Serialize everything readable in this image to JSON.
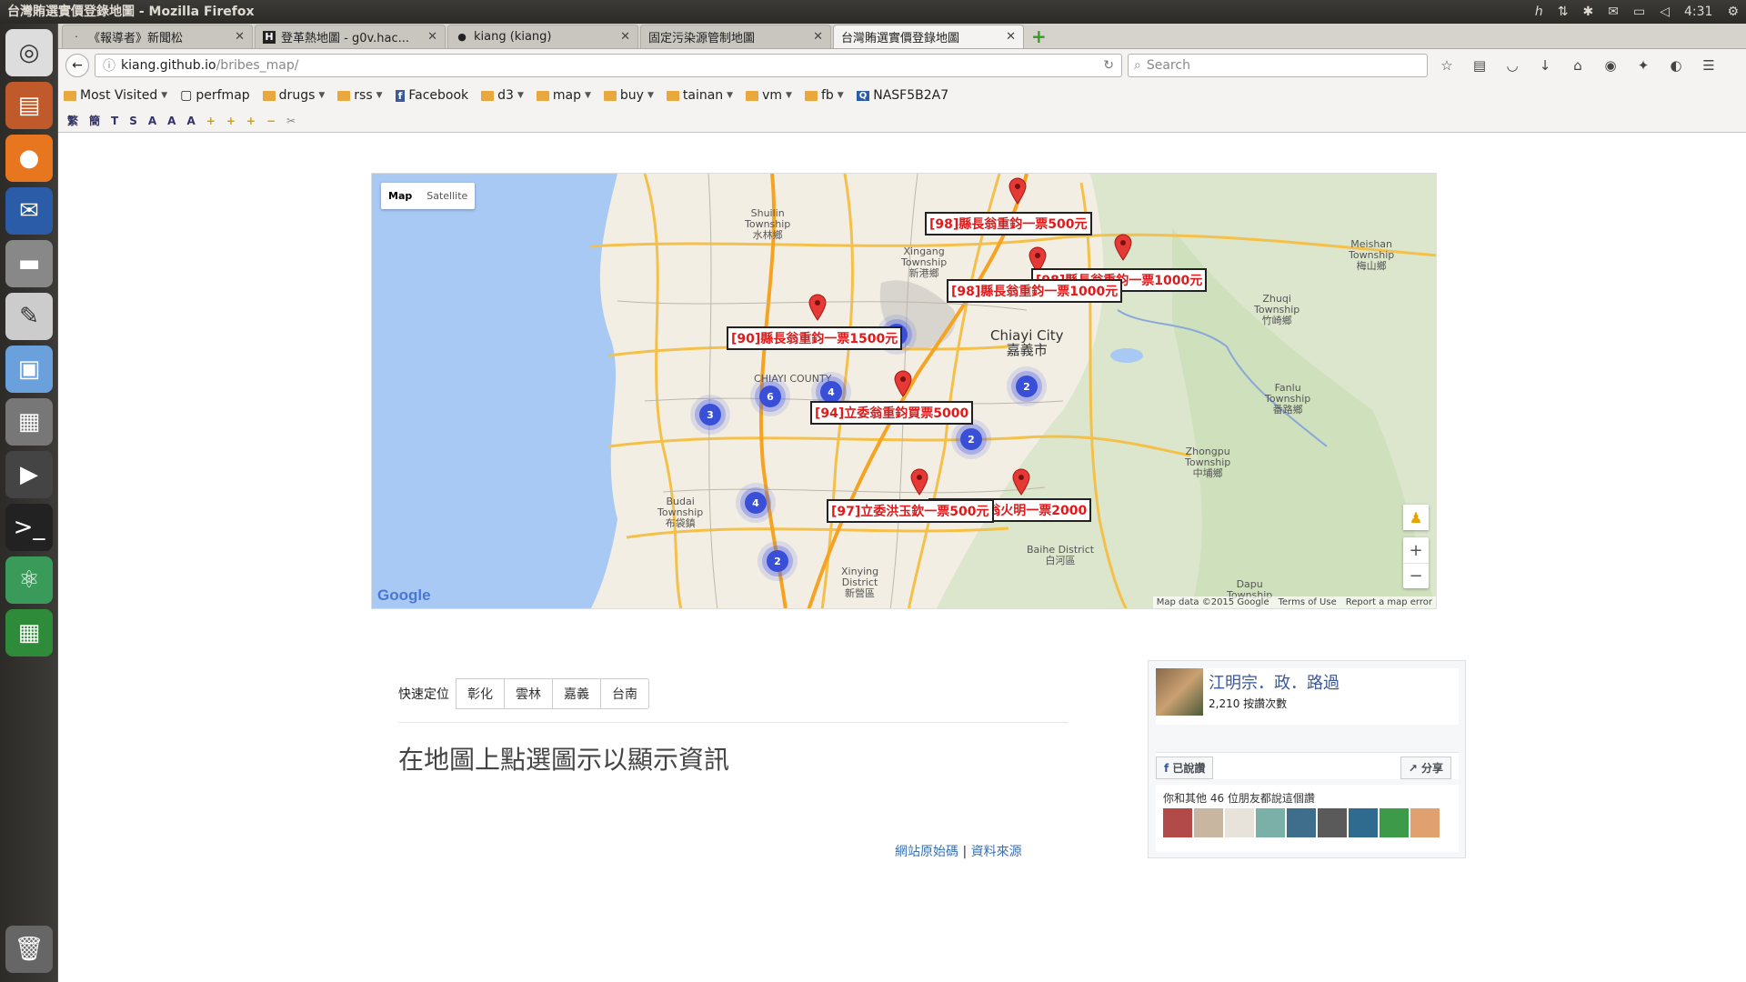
{
  "window_title": "台灣賄選實價登錄地圖 - Mozilla Firefox",
  "tray": {
    "time": "4:31"
  },
  "tabs": [
    {
      "label": "《報導者》新聞松",
      "active": false
    },
    {
      "label": "登革熱地圖 - g0v.hac...",
      "active": false
    },
    {
      "label": "kiang (kiang)",
      "active": false
    },
    {
      "label": "固定污染源管制地圖",
      "active": false
    },
    {
      "label": "台灣賄選實價登錄地圖",
      "active": true
    }
  ],
  "url": {
    "host": "kiang.github.io",
    "path": "/bribes_map/"
  },
  "search_placeholder": "Search",
  "bookmarks": [
    {
      "label": "Most Visited",
      "folder": true
    },
    {
      "label": "perfmap",
      "folder": false
    },
    {
      "label": "drugs",
      "folder": true
    },
    {
      "label": "rss",
      "folder": true
    },
    {
      "label": "Facebook",
      "folder": false
    },
    {
      "label": "d3",
      "folder": true
    },
    {
      "label": "map",
      "folder": true
    },
    {
      "label": "buy",
      "folder": true
    },
    {
      "label": "tainan",
      "folder": true
    },
    {
      "label": "vm",
      "folder": true
    },
    {
      "label": "fb",
      "folder": true
    },
    {
      "label": "NASF5B2A7",
      "folder": false
    }
  ],
  "map": {
    "type_map": "Map",
    "type_satellite": "Satellite",
    "labels": [
      "[98]縣長翁重鈞一票500元",
      "[98]縣長翁重鈞一票1000元",
      "[98]縣長翁重鈞一票1000元",
      "[90]縣長翁重鈞一票1500元",
      "[94]立委翁重鈞買票5000",
      "[97]立委洪玉欽一票500元",
      "[97]立委翁火明一票2000"
    ],
    "clusters": [
      "4",
      "6",
      "4",
      "3",
      "2",
      "2",
      "4",
      "2"
    ],
    "places": [
      {
        "name": "Shuilin\nTownship\n水林鄉"
      },
      {
        "name": "Xingang\nTownship\n新港鄉"
      },
      {
        "name": "Meishan\nTownship\n梅山鄉"
      },
      {
        "name": "Zhuqi\nTownship\n竹崎鄉"
      },
      {
        "name": "Fanlu\nTownship\n番路鄉"
      },
      {
        "name": "Zhongpu\nTownship\n中埔鄉"
      },
      {
        "name": "Budai\nTownship\n布袋鎮"
      },
      {
        "name": "Baihe District\n白河區"
      },
      {
        "name": "Xinying\nDistrict\n新營區"
      },
      {
        "name": "CHIAYI COUNTY"
      },
      {
        "name": "Dapu\nTownship"
      }
    ],
    "city": "Chiayi City\n嘉義市",
    "attrib": [
      "Map data ©2015 Google",
      "Terms of Use",
      "Report a map error"
    ],
    "logo": "Google"
  },
  "quick": {
    "label": "快速定位",
    "buttons": [
      "彰化",
      "雲林",
      "嘉義",
      "台南"
    ]
  },
  "prompt": "在地圖上點選圖示以顯示資訊",
  "fb": {
    "page_name": "江明宗．政．路過",
    "likes": "2,210 按讚次數",
    "liked": "已說讚",
    "share": "分享",
    "friends_text": "你和其他 46 位朋友都說這個讚"
  },
  "footer": {
    "source": "網站原始碼",
    "sep": "|",
    "data": "資料來源"
  },
  "colors": {
    "pin": "#e53935",
    "cluster": "#3a4fd8",
    "fb_blue": "#3b5998"
  }
}
